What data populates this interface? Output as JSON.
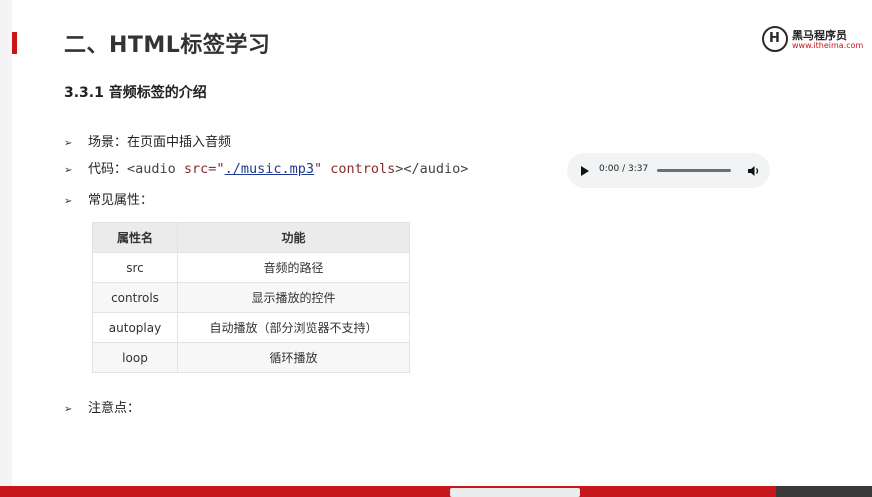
{
  "slide": {
    "title": "二、HTML标签学习",
    "section": "3.3.1 音频标签的介绍"
  },
  "logo": {
    "name": "黑马程序员",
    "url": "www.itheima.com",
    "mark": "H"
  },
  "bullets": {
    "scene_label": "场景：在页面中插入音频",
    "code_label": "代码：",
    "code_tag_open": "<audio ",
    "code_src_attr": "src=\"",
    "code_src_value": "./music.mp3",
    "code_quote": "\" ",
    "code_controls": "controls",
    "code_tag_close": "></audio>",
    "attrs_label": "常见属性：",
    "notes_label": "注意点："
  },
  "audio_player": {
    "time": "0:00 / 3:37",
    "progress": 0
  },
  "attr_table": {
    "headers": [
      "属性名",
      "功能"
    ],
    "rows": [
      [
        "src",
        "音频的路径"
      ],
      [
        "controls",
        "显示播放的控件"
      ],
      [
        "autoplay",
        "自动播放（部分浏览器不支持）"
      ],
      [
        "loop",
        "循环播放"
      ]
    ]
  },
  "colors": {
    "accent": "#c8161d",
    "player_bg": "#f1f3f4"
  }
}
